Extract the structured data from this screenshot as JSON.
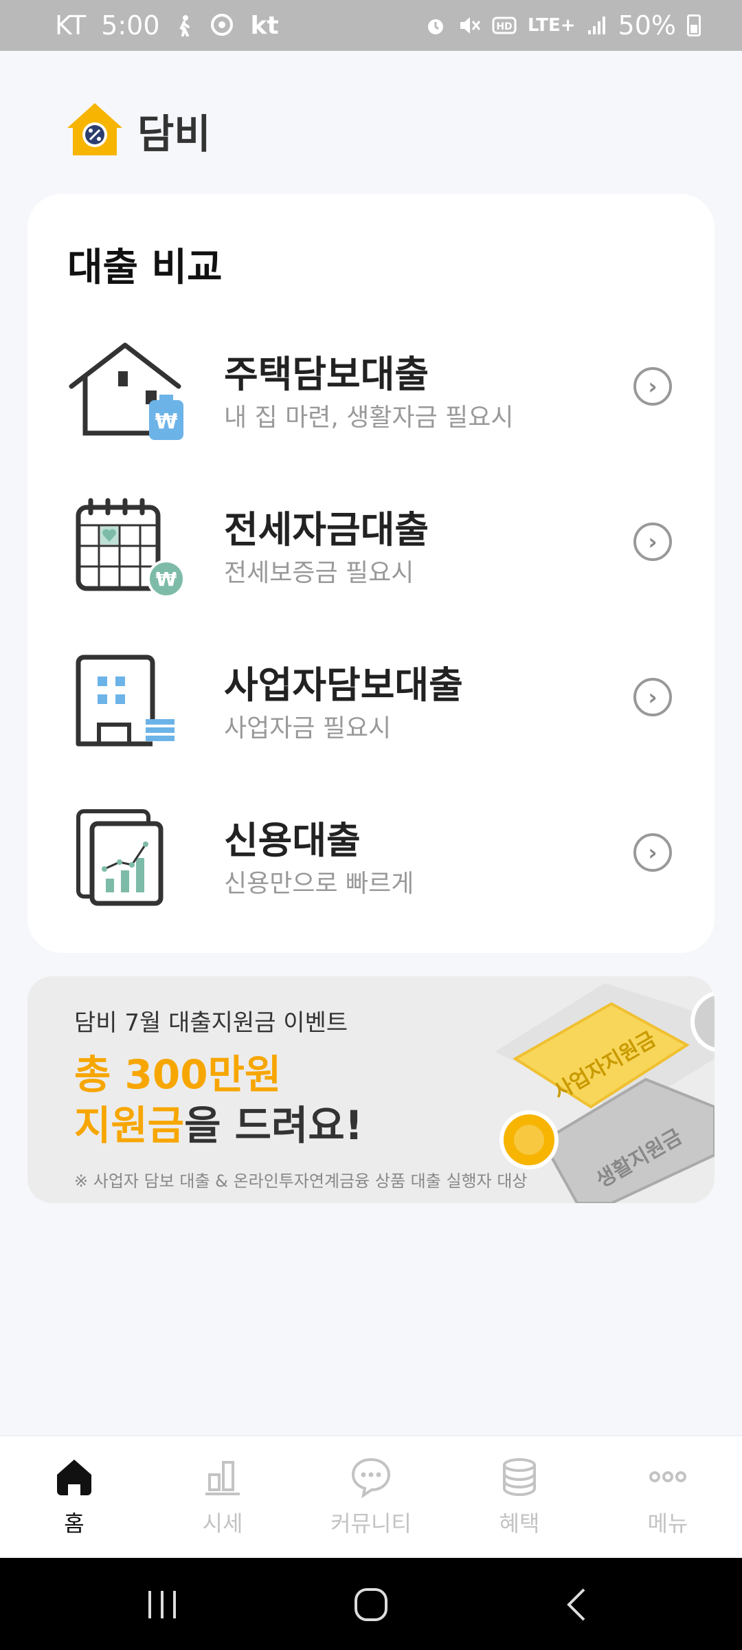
{
  "status_bar": {
    "carrier": "KT",
    "time": "5:00",
    "carrier_logo": "kt",
    "network": "LTE+",
    "battery": "50%"
  },
  "header": {
    "brand": "담비"
  },
  "loan_compare": {
    "title": "대출 비교",
    "items": [
      {
        "name": "주택담보대출",
        "desc": "내 집 마련, 생활자금 필요시",
        "icon": "house-won-icon"
      },
      {
        "name": "전세자금대출",
        "desc": "전세보증금 필요시",
        "icon": "calendar-won-icon"
      },
      {
        "name": "사업자담보대출",
        "desc": "사업자금 필요시",
        "icon": "building-icon"
      },
      {
        "name": "신용대출",
        "desc": "신용만으로 빠르게",
        "icon": "credit-chart-icon"
      }
    ]
  },
  "banner": {
    "subtitle": "담비 7월 대출지원금 이벤트",
    "headline1": "총 300만원",
    "headline2_highlight": "지원금",
    "headline2_rest": "을 드려요!",
    "note": "※ 사업자 담보 대출 & 온라인투자연계금융 상품 대출 실행자 대상",
    "coupon1": "사업자지원금",
    "coupon2": "생활지원금"
  },
  "bottom_nav": {
    "items": [
      {
        "label": "홈",
        "icon": "home-icon",
        "active": true
      },
      {
        "label": "시세",
        "icon": "bar-chart-icon",
        "active": false
      },
      {
        "label": "커뮤니티",
        "icon": "chat-bubble-icon",
        "active": false
      },
      {
        "label": "혜택",
        "icon": "coin-stack-icon",
        "active": false
      },
      {
        "label": "메뉴",
        "icon": "more-dots-icon",
        "active": false
      }
    ]
  },
  "colors": {
    "accent": "#f7a600",
    "sky": "#6cb3e8",
    "mint": "#7dbba8",
    "text_dark": "#222222",
    "text_muted": "#999999"
  }
}
